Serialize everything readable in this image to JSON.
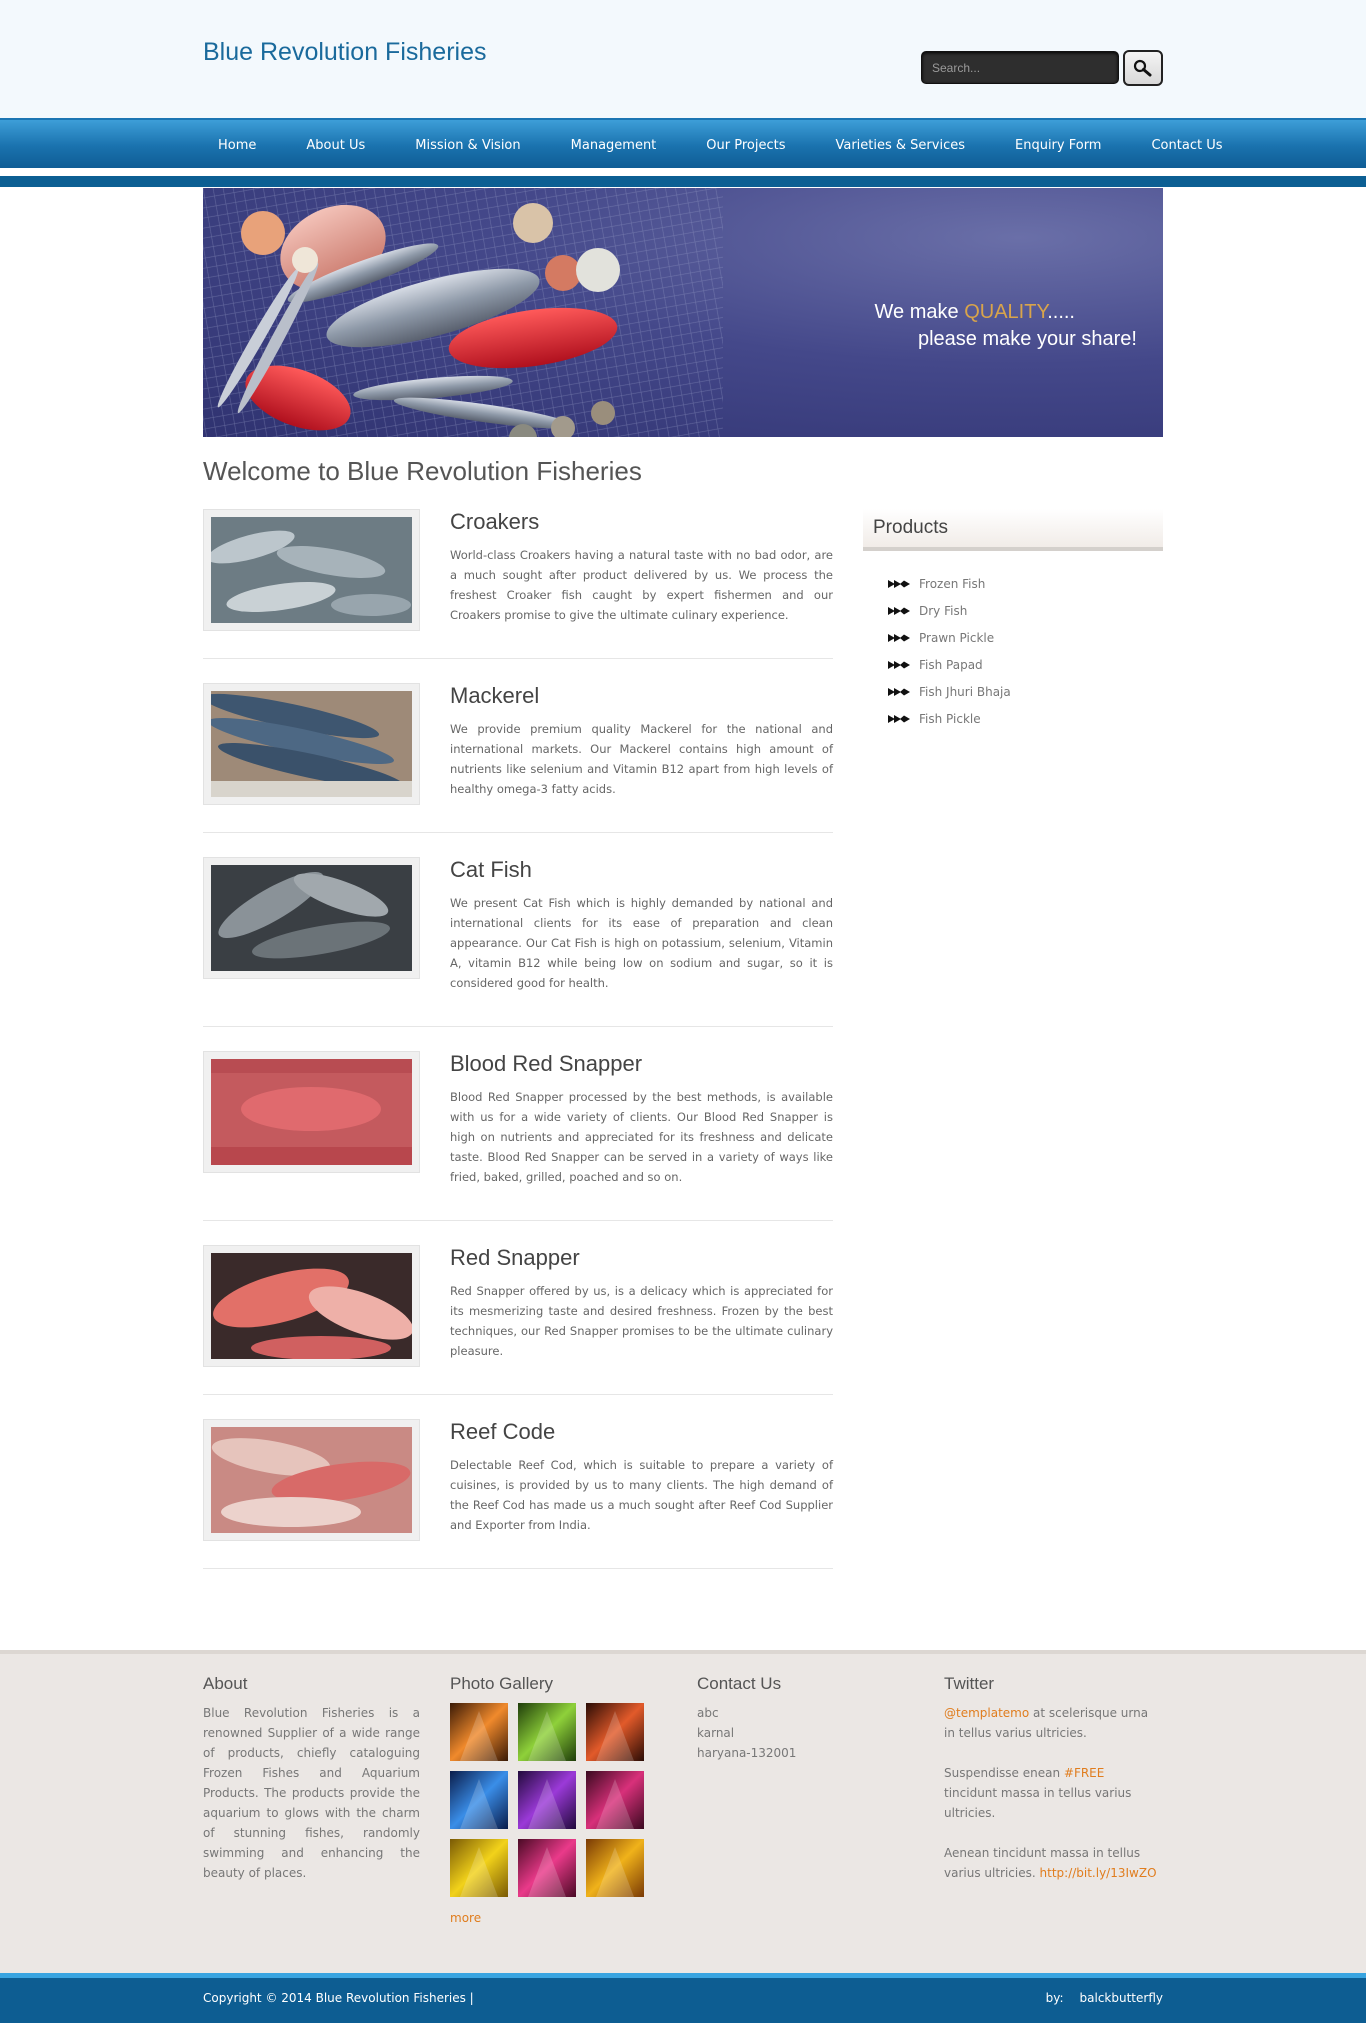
{
  "header": {
    "site_title": "Blue Revolution Fisheries",
    "search_placeholder": "Search..."
  },
  "nav": {
    "items": [
      "Home",
      "About Us",
      "Mission & Vision",
      "Management",
      "Our Projects",
      "Varieties & Services",
      "Enquiry Form",
      "Contact Us"
    ]
  },
  "banner": {
    "line1_prefix": "We make ",
    "line1_highlight": "QUALITY",
    "line1_suffix": ".....",
    "line2": "please make your share!"
  },
  "main": {
    "welcome": "Welcome to Blue Revolution Fisheries",
    "products": [
      {
        "title": "Croakers",
        "description": "World-class Croakers having a natural taste with no bad odor, are a much sought after product delivered by us. We process the freshest Croaker fish caught by expert fishermen and our Croakers promise to give the ultimate culinary experience."
      },
      {
        "title": "Mackerel",
        "description": "We provide premium quality Mackerel for the national and international markets. Our Mackerel contains high amount of nutrients like selenium and Vitamin B12 apart from high levels of healthy omega-3 fatty acids."
      },
      {
        "title": "Cat Fish",
        "description": "We present Cat Fish which is highly demanded by national and international clients for its ease of preparation and clean appearance. Our Cat Fish is high on potassium, selenium, Vitamin A, vitamin B12 while being low on sodium and sugar, so it is considered good for health."
      },
      {
        "title": "Blood Red Snapper",
        "description": "Blood Red Snapper processed by the best methods, is available with us for a wide variety of clients. Our Blood Red Snapper is high on nutrients and appreciated for its freshness and delicate taste. Blood Red Snapper can be served in a variety of ways like fried, baked, grilled, poached and so on."
      },
      {
        "title": "Red Snapper",
        "description": "Red Snapper offered by us, is a delicacy which is appreciated for its mesmerizing taste and desired freshness. Frozen by the best techniques, our Red Snapper promises to be the ultimate culinary pleasure."
      },
      {
        "title": "Reef Code",
        "description": "Delectable Reef Cod, which is suitable to prepare a variety of cuisines, is provided by us to many clients. The high demand of the Reef Cod has made us a much sought after Reef Cod Supplier and Exporter from India."
      }
    ]
  },
  "sidebar": {
    "title": "Products",
    "items": [
      "Frozen Fish",
      "Dry Fish",
      "Prawn Pickle",
      "Fish Papad",
      "Fish Jhuri Bhaja",
      "Fish Pickle"
    ]
  },
  "footer": {
    "about_heading": "About",
    "about_text": "Blue Revolution Fisheries is a renowned Supplier of a wide range of products, chiefly cataloguing Frozen Fishes and Aquarium Products. The products provide the aquarium to glows with the charm of stunning fishes, randomly swimming and enhancing the beauty of places.",
    "gallery_heading": "Photo Gallery",
    "gallery_more": "more",
    "gallery_colors": [
      [
        "#f08a2c",
        "#3a1a06"
      ],
      [
        "#8fd13a",
        "#1f3d0a"
      ],
      [
        "#e25a2a",
        "#2a0c05"
      ],
      [
        "#3a8ee8",
        "#0a1c4a"
      ],
      [
        "#9b3ad8",
        "#220a3c"
      ],
      [
        "#d8307a",
        "#3a0a20"
      ],
      [
        "#f2d21a",
        "#7a5a05"
      ],
      [
        "#ea3a8a",
        "#4a0a25"
      ],
      [
        "#f0b21a",
        "#7a3a05"
      ]
    ],
    "contact_heading": "Contact Us",
    "contact_lines": [
      "abc",
      "karnal",
      "haryana-132001"
    ],
    "twitter_heading": "Twitter",
    "tweet1_link": "@templatemo",
    "tweet1_text": " at scelerisque urna in tellus varius ultricies.",
    "tweet2_pre": "Suspendisse enean ",
    "tweet2_tag": "#FREE",
    "tweet2_post": " tincidunt massa in tellus varius ultricies.",
    "tweet3_text": "Aenean tincidunt massa in tellus varius ultricies. ",
    "tweet3_link": "http://bit.ly/13IwZO",
    "copyright": "Copyright © 2014 Blue Revolution Fisheries |",
    "credit_label": "by:",
    "credit_name": "balckbutterfly"
  },
  "colors": {
    "brand_blue": "#1a6a9c",
    "nav_blue": "#1a72ae",
    "accent_orange": "#e07d1e",
    "footer_bg": "#ebe7e4"
  },
  "icons": {
    "search": "magnifier-icon",
    "list_bullet": "fish-arrow-icon"
  }
}
